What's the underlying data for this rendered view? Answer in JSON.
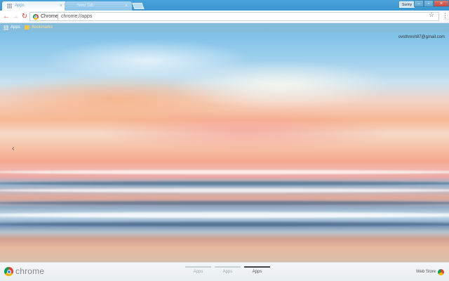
{
  "tabs": [
    {
      "label": "Apps",
      "active": true
    },
    {
      "label": "New Tab",
      "active": false
    }
  ],
  "window": {
    "user_label": "Sunny"
  },
  "toolbar": {
    "omnibox_chip": "Chrome",
    "url": "chrome://apps"
  },
  "bookmarks": [
    {
      "label": "Apps",
      "icon": "apps-grid-icon"
    },
    {
      "label": "Bookmarks",
      "icon": "folder-icon"
    }
  ],
  "content": {
    "account_email": "ovsthresh87@gmail.com"
  },
  "footer": {
    "brand": "chrome",
    "pages": [
      {
        "label": "Apps",
        "active": false
      },
      {
        "label": "Apps",
        "active": false
      },
      {
        "label": "Apps",
        "active": true
      }
    ],
    "webstore_label": "Web Store"
  }
}
